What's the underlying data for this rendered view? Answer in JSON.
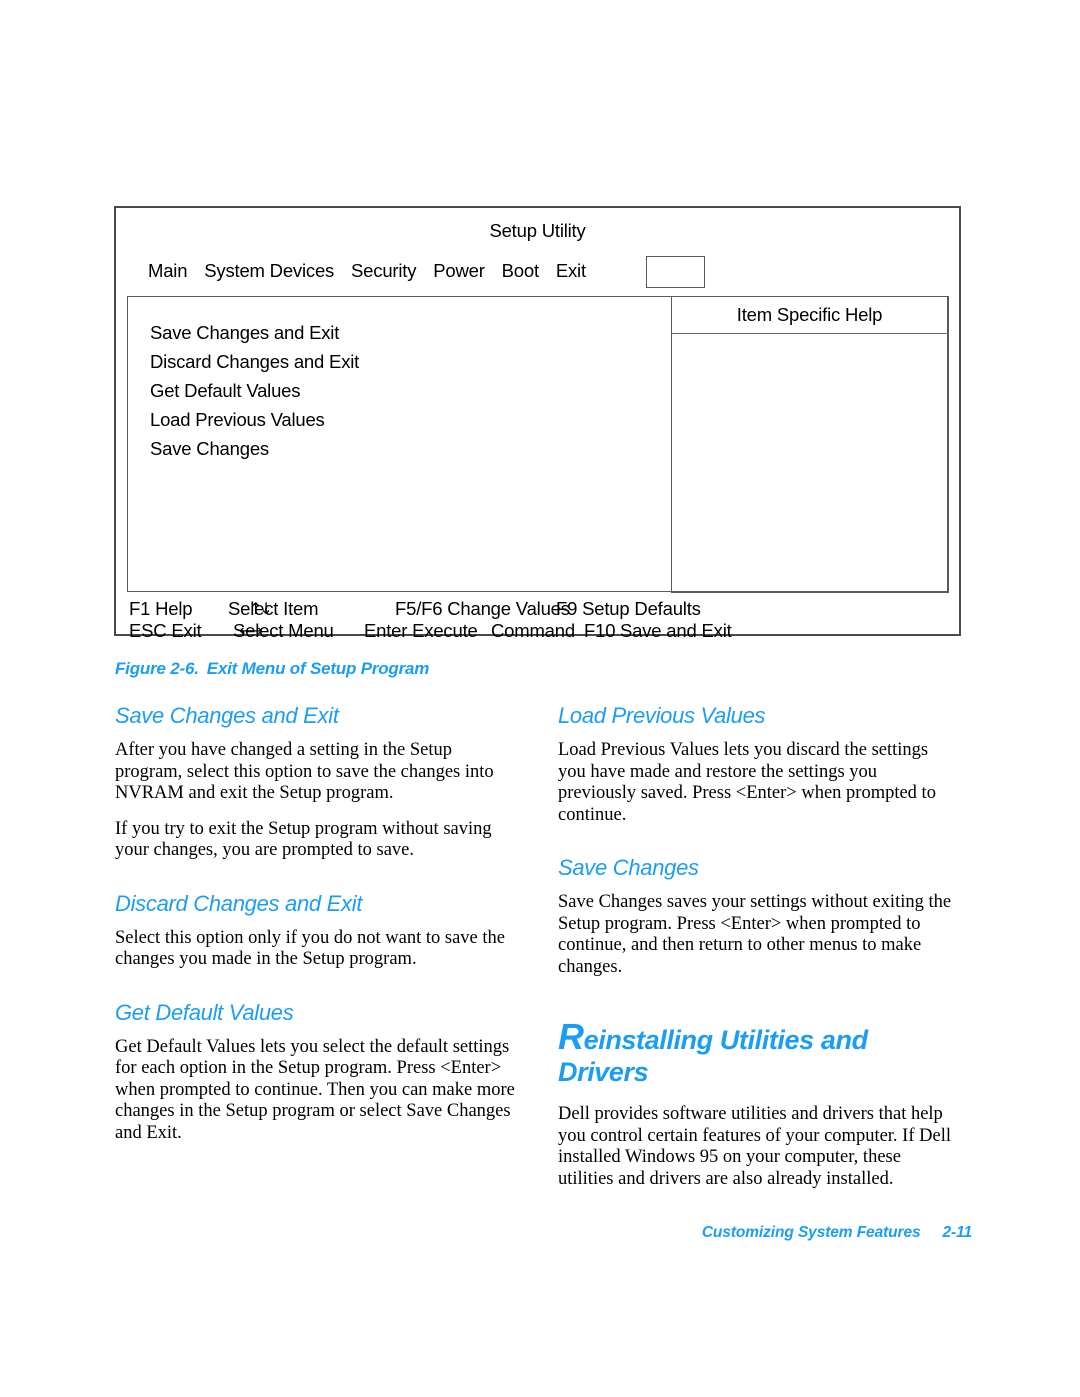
{
  "figure": {
    "screen_title": "Setup Utility",
    "menu_tabs": [
      "Main",
      "System Devices",
      "Security",
      "Power",
      "Boot",
      "Exit"
    ],
    "help_panel_title": "Item Specific Help",
    "options": [
      "Save Changes and Exit",
      "Discard Changes and Exit",
      "Get Default Values",
      "Load Previous Values",
      "Save Changes"
    ],
    "key_help_row1": {
      "f1": "F1 Help",
      "updown_arrows": "↑↓",
      "select_item": "Select Item",
      "f5f6": "F5/F6 Change Values",
      "f9": "F9 Setup Defaults"
    },
    "key_help_row2": {
      "esc": "ESC Exit",
      "leftright_arrows": "←→",
      "select_menu": "Select Menu",
      "enter": "Enter Execute",
      "command": "Command",
      "f10": "F10",
      "save_and_exit": "Save and Exit"
    },
    "caption_label": "Figure 2-6.",
    "caption_text": "Exit Menu of Setup Program"
  },
  "left_column": {
    "sections": [
      {
        "heading": "Save Changes and Exit",
        "paragraphs": [
          "After you have changed a setting in the Setup program, select this option to save the changes into NVRAM and exit the Setup program.",
          "If you try to exit the Setup program without saving your changes, you are prompted to save."
        ]
      },
      {
        "heading": "Discard Changes and Exit",
        "paragraphs": [
          "Select this option only if you do not want to save the changes you made in the Setup program."
        ]
      },
      {
        "heading": "Get Default Values",
        "paragraphs": [
          "Get Default Values lets you select the default settings for each option in the Setup program. Press <Enter> when prompted to continue. Then you can make more changes in the Setup program or select Save Changes and Exit."
        ]
      }
    ]
  },
  "right_column": {
    "sections": [
      {
        "heading": "Load Previous Values",
        "paragraphs": [
          "Load Previous Values lets you discard the settings you have made and restore the settings you previously saved. Press <Enter> when prompted to continue."
        ]
      },
      {
        "heading": "Save Changes",
        "paragraphs": [
          "Save Changes saves your settings without exiting the Setup program. Press <Enter> when prompted to continue, and then return to other menus to make changes."
        ]
      }
    ],
    "major_section": {
      "drop_cap": "R",
      "heading_rest": "einstalling Utilities and Drivers",
      "paragraphs": [
        "Dell provides software utilities and drivers that help you control certain features of your computer. If Dell installed Windows 95 on your computer, these utilities and drivers are also already installed."
      ]
    }
  },
  "footer": {
    "chapter_title": "Customizing System Features",
    "page_number": "2-11"
  },
  "colors": {
    "heading_blue": "#1b9df5",
    "body_text": "#000000",
    "figure_border": "#4a4a4a"
  }
}
